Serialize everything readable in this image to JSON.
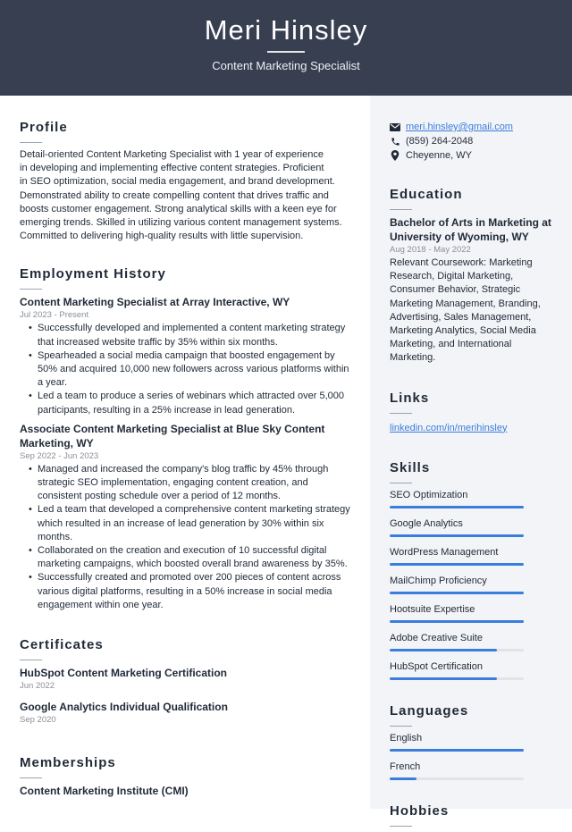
{
  "header": {
    "name": "Meri Hinsley",
    "title": "Content Marketing Specialist"
  },
  "profile": {
    "heading": "Profile",
    "lines": [
      "Detail-oriented Content Marketing Specialist with 1 year of experience",
      "in developing and implementing effective content strategies. Proficient",
      "in SEO optimization, social media engagement, and brand development.",
      "Demonstrated ability to create compelling content that drives traffic and",
      "boosts customer engagement. Strong analytical skills with a keen eye for",
      "emerging trends. Skilled in utilizing various content management systems.",
      "Committed to delivering high-quality results with little supervision."
    ]
  },
  "employment": {
    "heading": "Employment History",
    "jobs": [
      {
        "title": "Content Marketing Specialist at Array Interactive, WY",
        "dates": "Jul 2023 - Present",
        "bullets": [
          "Successfully developed and implemented a content marketing strategy that increased website traffic by 35% within six months.",
          "Spearheaded a social media campaign that boosted engagement by 50% and acquired 10,000 new followers across various platforms within a year.",
          "Led a team to produce a series of webinars which attracted over 5,000 participants, resulting in a 25% increase in lead generation."
        ]
      },
      {
        "title": "Associate Content Marketing Specialist at Blue Sky Content Marketing, WY",
        "dates": "Sep 2022 - Jun 2023",
        "bullets": [
          "Managed and increased the company's blog traffic by 45% through strategic SEO implementation, engaging content creation, and consistent posting schedule over a period of 12 months.",
          "Led a team that developed a comprehensive content marketing strategy which resulted in an increase of lead generation by 30% within six months.",
          "Collaborated on the creation and execution of 10 successful digital marketing campaigns, which boosted overall brand awareness by 35%.",
          "Successfully created and promoted over 200 pieces of content across various digital platforms, resulting in a 50% increase in social media engagement within one year."
        ]
      }
    ]
  },
  "certificates": {
    "heading": "Certificates",
    "items": [
      {
        "name": "HubSpot Content Marketing Certification",
        "date": "Jun 2022"
      },
      {
        "name": "Google Analytics Individual Qualification",
        "date": "Sep 2020"
      }
    ]
  },
  "memberships": {
    "heading": "Memberships",
    "items": [
      "Content Marketing Institute (CMI)"
    ]
  },
  "contact": {
    "email": "meri.hinsley@gmail.com",
    "phone": "(859) 264-2048",
    "location": "Cheyenne, WY"
  },
  "education": {
    "heading": "Education",
    "degree": "Bachelor of Arts in Marketing at University of Wyoming, WY",
    "dates": "Aug 2018 - May 2022",
    "description": "Relevant Coursework: Marketing Research, Digital Marketing, Consumer Behavior, Strategic Marketing Management, Branding, Advertising, Sales Management, Marketing Analytics, Social Media Marketing, and International Marketing."
  },
  "links": {
    "heading": "Links",
    "items": [
      "linkedin.com/in/merihinsley"
    ]
  },
  "skills": {
    "heading": "Skills",
    "items": [
      {
        "name": "SEO Optimization",
        "level": 1.0
      },
      {
        "name": "Google Analytics",
        "level": 1.0
      },
      {
        "name": "WordPress Management",
        "level": 1.0
      },
      {
        "name": "MailChimp Proficiency",
        "level": 1.0
      },
      {
        "name": "Hootsuite Expertise",
        "level": 1.0
      },
      {
        "name": "Adobe Creative Suite",
        "level": 0.8
      },
      {
        "name": "HubSpot Certification",
        "level": 0.8
      }
    ]
  },
  "languages": {
    "heading": "Languages",
    "items": [
      {
        "name": "English",
        "level": 1.0
      },
      {
        "name": "French",
        "level": 0.2
      }
    ]
  },
  "hobbies": {
    "heading": "Hobbies"
  },
  "colors": {
    "header_bg": "#373f51",
    "accent": "#3b7ddd",
    "sidebar_bg": "#f3f4f7"
  }
}
